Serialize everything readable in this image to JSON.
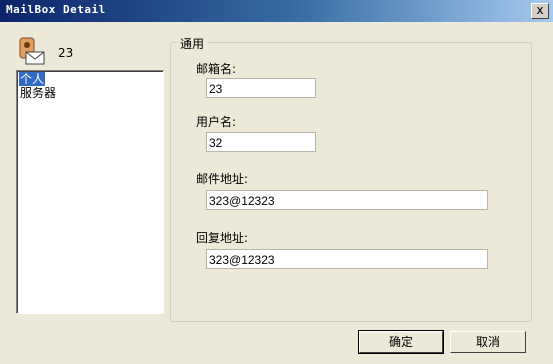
{
  "window": {
    "title": "MailBox Detail",
    "close_label": "x"
  },
  "account": {
    "name": "23"
  },
  "sidebar": {
    "items": [
      {
        "label": "个人",
        "selected": true
      },
      {
        "label": "服务器",
        "selected": false
      }
    ]
  },
  "group": {
    "title": "通用",
    "fields": [
      {
        "label": "邮箱名:",
        "value": "23"
      },
      {
        "label": "用户名:",
        "value": "32"
      },
      {
        "label": "邮件地址:",
        "value": "323@12323"
      },
      {
        "label": "回复地址:",
        "value": "323@12323"
      }
    ]
  },
  "buttons": {
    "ok": "确定",
    "cancel": "取消"
  },
  "colors": {
    "selection": "#316ac5",
    "dialog_bg": "#ece9d8"
  }
}
